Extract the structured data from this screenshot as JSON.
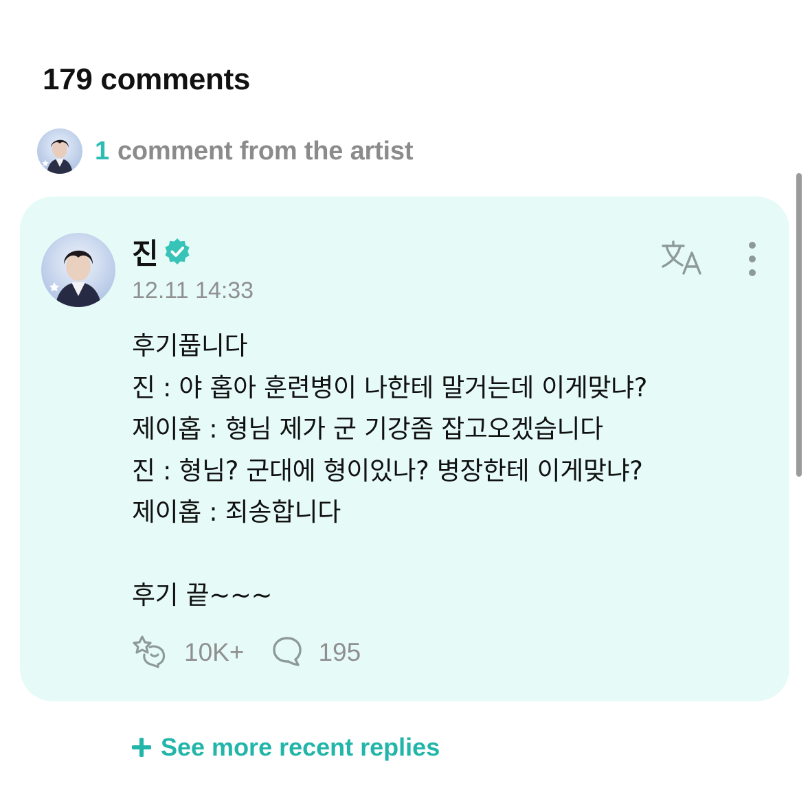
{
  "header": {
    "comments_count_label": "179 comments"
  },
  "artist_summary": {
    "count": "1",
    "label": "comment from the artist",
    "avatar_icon": "artist-avatar"
  },
  "comment": {
    "author": "진",
    "verified_icon": "verified-badge-icon",
    "timestamp": "12.11 14:33",
    "body": "후기풉니다\n진 : 야 홉아 훈련병이 나한테 말거는데 이게맞냐?\n제이홉 : 형님 제가 군 기강좀 잡고오겠습니다\n진 : 형님? 군대에 형이있나? 병장한테 이게맞냐?\n제이홉 : 죄송합니다\n\n후기 끝~~~",
    "translate_icon": "translate-icon",
    "more_icon": "more-vertical-icon",
    "reactions": {
      "icon": "reaction-icon",
      "count": "10K+"
    },
    "replies": {
      "icon": "reply-bubble-icon",
      "count": "195"
    }
  },
  "footer": {
    "see_more_label": "See more recent replies"
  },
  "colors": {
    "accent": "#22b5aa",
    "card_background": "#e6fbf7",
    "muted_text": "#8f8f8f",
    "primary_text": "#111111"
  }
}
